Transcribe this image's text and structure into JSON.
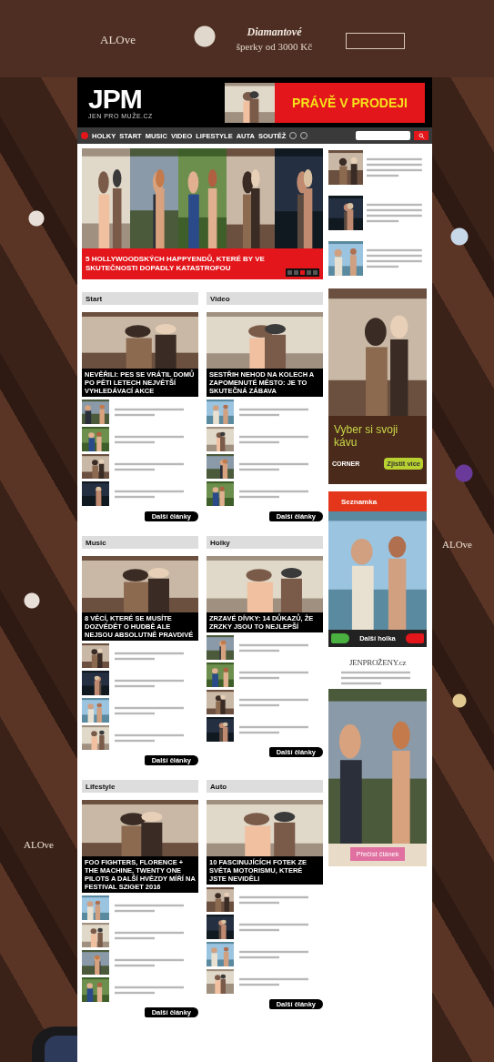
{
  "background_ad": {
    "brand_marks": [
      "ALOve",
      "ALOve",
      "ALOve"
    ],
    "headline": "Diamantové",
    "subline": "šperky od 3000 Kč"
  },
  "header": {
    "logo": "JPM",
    "logo_tagline": "JEN PRO MUŽE.CZ",
    "banner_text": "PRÁVĚ V PRODEJI"
  },
  "nav": {
    "items": [
      "HOLKY",
      "START",
      "MUSIC",
      "VIDEO",
      "LIFESTYLE",
      "AUTA",
      "SOUTĚŽ"
    ]
  },
  "featured": {
    "headline": "5 HOLLYWOODSKÝCH HAPPYENDŮ, KTERÉ BY VE SKUTEČNOSTI DOPADLY KATASTROFOU",
    "pages": [
      {
        "selected": false
      },
      {
        "selected": false
      },
      {
        "selected": true
      },
      {
        "selected": false
      },
      {
        "selected": false
      }
    ]
  },
  "sections": [
    {
      "title": "Start",
      "headline": "NEVĚŘILI: PES SE VRÁTIL DOMŮ PO PĚTI LETECH NEJVĚTŠÍ VYHLEDÁVACÍ AKCE",
      "more": "Další články"
    },
    {
      "title": "Video",
      "headline": "SESTŘIH NEHOD NA KOLECH A ZAPOMENUTÉ MĚSTO: JE TO SKUTEČNÁ ZÁBAVA",
      "more": "Další články"
    },
    {
      "title": "Music",
      "headline": "8 VĚCÍ, KTERÉ SE MUSÍTE DOZVĚDĚT O HUDBĚ ALE NEJSOU ABSOLUTNĚ PRAVDIVÉ",
      "more": "Další články"
    },
    {
      "title": "Holky",
      "headline": "ZRZAVÉ DÍVKY: 14 DŮKAZŮ, ŽE ZRZKY JSOU TO NEJLEPŠÍ",
      "more": "Další články"
    },
    {
      "title": "Lifestyle",
      "headline": "FOO FIGHTERS, FLORENCE + THE MACHINE, TWENTY ONE PILOTS A DALŠÍ HVĚZDY MÍŘÍ NA FESTIVAL SZIGET 2016",
      "more": "Další články"
    },
    {
      "title": "Auto",
      "headline": "10 FASCINUJÍCÍCH FOTEK ZE SVĚTA MOTORISMU, KTERÉ JSTE NEVIDĚLI",
      "more": "Další články"
    }
  ],
  "coffee_ad": {
    "slogan": "Vyber si svoji kávu",
    "brand": "CORNER",
    "button": "Zjistit více"
  },
  "dating_widget": {
    "title": "Seznamka",
    "caption": "Další holka"
  },
  "women_ad": {
    "logo": "JENPROŽENY.cz",
    "button": "Přečíst článek"
  }
}
